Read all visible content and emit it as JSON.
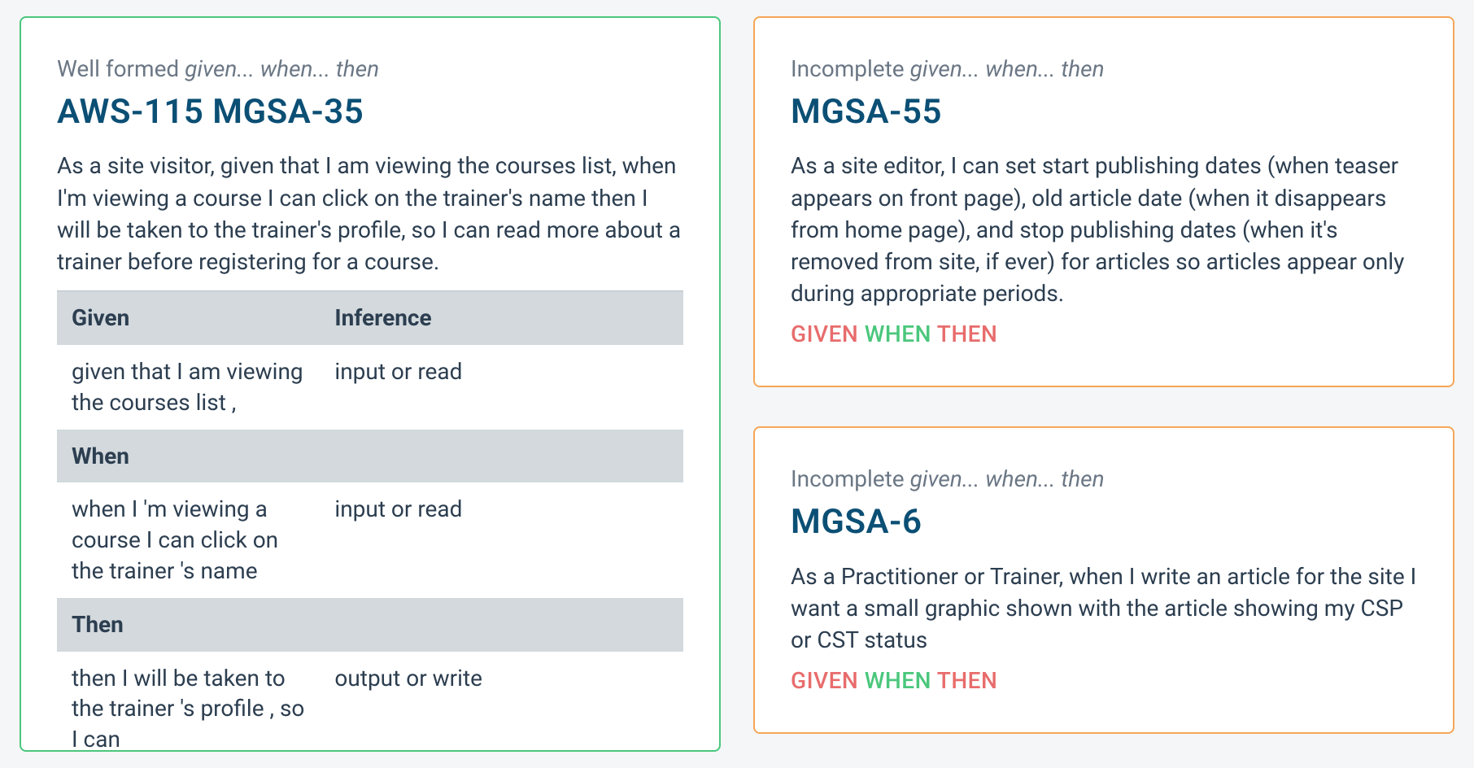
{
  "left": {
    "status_prefix": "Well formed ",
    "status_italic": "given... when... then",
    "title": "AWS-115 MGSA-35",
    "body": "As a site visitor, given that I am viewing the courses list, when I'm viewing a course I can click on the trainer's name then I will be taken to the trainer's profile, so I can read more about a trainer before registering for a course.",
    "table": {
      "col1_header": "Given",
      "col2_header": "Inference",
      "rows": [
        {
          "label_header": "Given",
          "text": "given that I am viewing the courses list ,",
          "inference": "input or read",
          "is_first": true
        },
        {
          "label_header": "When",
          "text": "when I 'm viewing a course I can click on the trainer 's name",
          "inference": "input or read",
          "is_first": false
        },
        {
          "label_header": "Then",
          "text": "then I will be taken to the trainer 's profile , so I can",
          "inference": "output or write",
          "is_first": false
        }
      ]
    }
  },
  "right": [
    {
      "status_prefix": "Incomplete ",
      "status_italic": "given... when... then",
      "title": "MGSA-55",
      "body": "As a site editor, I can set start publishing dates (when teaser appears on front page), old article date (when it disappears from home page), and stop publishing dates (when it's removed from site, if ever) for articles so articles appear only during appropriate periods.",
      "tags": {
        "given": "GIVEN",
        "when": "WHEN",
        "then": "THEN"
      }
    },
    {
      "status_prefix": "Incomplete ",
      "status_italic": "given... when... then",
      "title": "MGSA-6",
      "body": "As a Practitioner or Trainer, when I write an article for the site I want a small graphic shown with the article showing my CSP or CST status",
      "tags": {
        "given": "GIVEN",
        "when": "WHEN",
        "then": "THEN"
      }
    }
  ]
}
